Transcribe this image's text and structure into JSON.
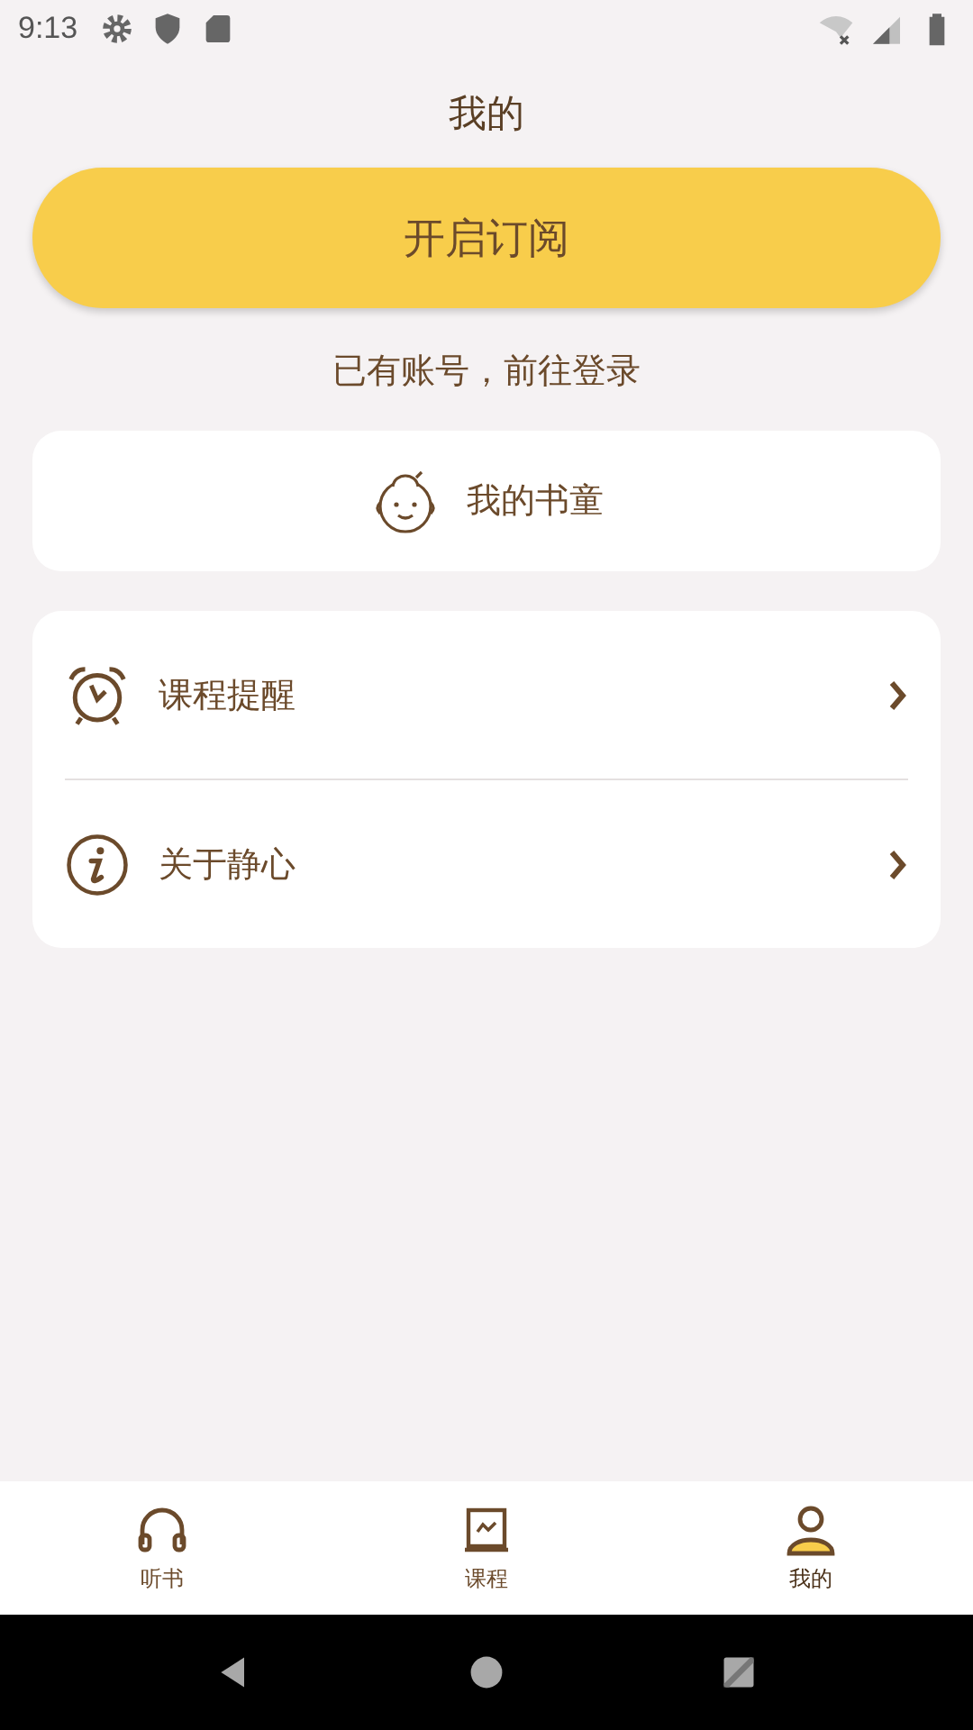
{
  "status_bar": {
    "time": "9:13"
  },
  "title": "我的",
  "subscribe_button": "开启订阅",
  "login_link": "已有账号，前往登录",
  "kid_card": {
    "label": "我的书童"
  },
  "menu": [
    {
      "kind": "alarm",
      "label": "课程提醒"
    },
    {
      "kind": "info",
      "label": "关于静心"
    }
  ],
  "tabs": [
    {
      "kind": "headphones",
      "label": "听书",
      "selected": false
    },
    {
      "kind": "chart",
      "label": "课程",
      "selected": false
    },
    {
      "kind": "person",
      "label": "我的",
      "selected": true
    }
  ]
}
